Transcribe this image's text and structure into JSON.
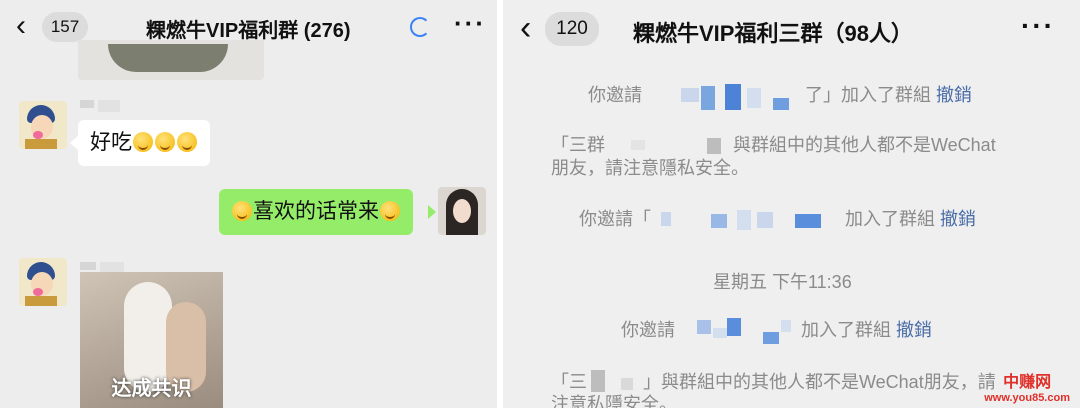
{
  "left": {
    "header": {
      "back_count": "157",
      "title": "粿燃牛VIP福利群 (276)"
    },
    "messages": {
      "m1_text": "好吃",
      "m2_text": "喜欢的话常来",
      "image_caption": "达成共识"
    }
  },
  "right": {
    "header": {
      "back_count": "120",
      "title": "粿燃牛VIP福利三群（98人）"
    },
    "notices": {
      "n1_prefix": "你邀請",
      "n1_mid": "了」加入了群組",
      "n1_action": "撤銷",
      "n2_line1": "「三群",
      "n2_line1b": "與群組中的其他人都不是WeChat",
      "n2_line2": "朋友，請注意隱私安全。",
      "n3_prefix": "你邀請「",
      "n3_mid": "加入了群組",
      "n3_action": "撤銷",
      "timestamp": "星期五 下午11:36",
      "n4_prefix": "你邀請",
      "n4_mid": "加入了群組",
      "n4_action": "撤銷",
      "n5_line1": "「三",
      "n5_line1b": "」與群組中的其他人都不是WeChat朋友，請",
      "n5_line2": "注意私隱安全。"
    }
  },
  "watermark": {
    "line1": "中赚网",
    "line2": "www.you85.com"
  },
  "colors": {
    "bubble_green": "#95ec69",
    "link_blue": "#4a6da7",
    "system_gray": "#8b8b8b"
  },
  "icons": [
    "back-chevron-icon",
    "loading-ring-icon",
    "more-dots-icon"
  ]
}
